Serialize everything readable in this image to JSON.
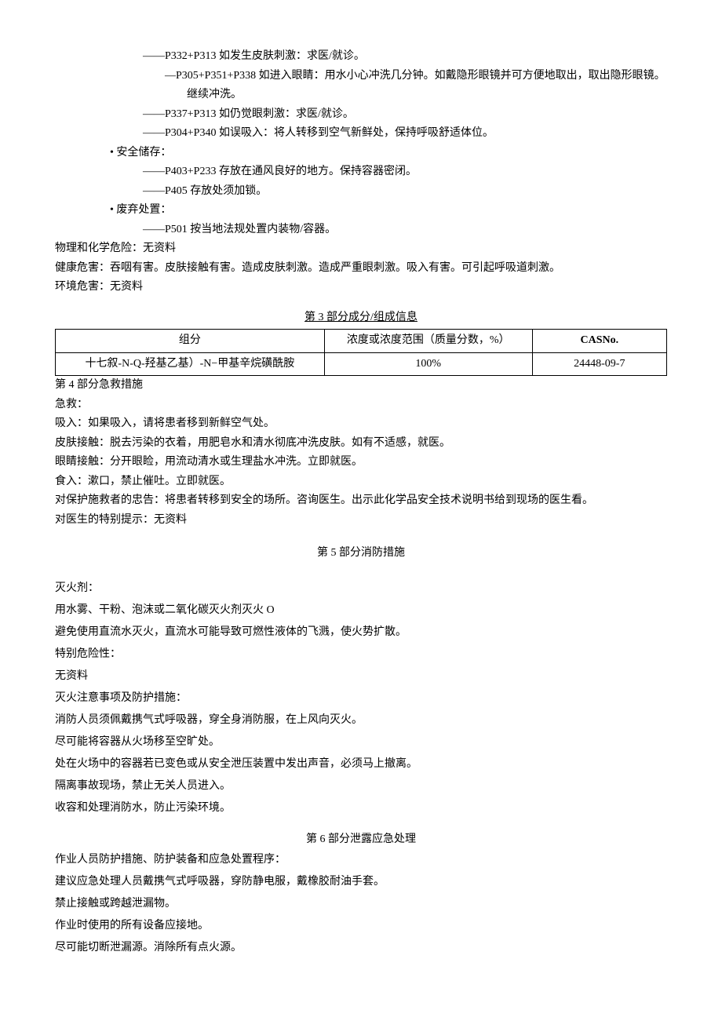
{
  "top": {
    "l1": "——P332+P313 如发生皮肤刺激：求医/就诊。",
    "l2": "—P305+P351+P338 如进入眼睛：用水小心冲洗几分钟。如戴隐形眼镜并可方便地取出，取出隐形眼镜。继续冲洗。",
    "l3": "——P337+P313 如仍觉眼刺激：求医/就诊。",
    "l4": "——P304+P340 如误吸入：将人转移到空气新鲜处，保持呼吸舒适体位。",
    "storage_label": "• 安全储存：",
    "s1": "——P403+P233 存放在通风良好的地方。保持容器密闭。",
    "s2": "——P405 存放处须加锁。",
    "disposal_label": "• 废弃处置：",
    "d1": "——P501 按当地法规处置内装物/容器。",
    "ph": "物理和化学危险：无资料",
    "hh": "健康危害：吞咽有害。皮肤接触有害。造成皮肤刺激。造成严重眼刺激。吸入有害。可引起呼吸道刺激。",
    "eh": "环境危害：无资料"
  },
  "sec3": {
    "title": "第 3 部分成分/组成信息",
    "headers": {
      "c1": "组分",
      "c2": "浓度或浓度范围（质量分数，%）",
      "c3": "CASNo."
    },
    "row": {
      "c1": "十七叙-N-Q-羟基乙基）-N−甲基辛烷磺酰胺",
      "c2": "100%",
      "c3": "24448-09-7"
    }
  },
  "sec4": {
    "heading": "第 4 部分急救措施",
    "l1": "急救：",
    "l2": "吸入：如果吸入，请将患者移到新鲜空气处。",
    "l3": "皮肤接触：脱去污染的衣着，用肥皂水和清水彻底冲洗皮肤。如有不适感，就医。",
    "l4": "眼睛接触：分开眼睑，用流动清水或生理盐水冲洗。立即就医。",
    "l5": "食入：漱口，禁止催吐。立即就医。",
    "l6": "对保护施救者的忠告：将患者转移到安全的场所。咨询医生。出示此化学品安全技术说明书给到现场的医生看。",
    "l7": "对医生的特别提示：无资料"
  },
  "sec5": {
    "title": "第 5 部分消防措施",
    "l1": "灭火剂：",
    "l2": "用水雾、干粉、泡沫或二氧化碳灭火剂灭火 O",
    "l3": "避免使用直流水灭火，直流水可能导致可燃性液体的飞溅，使火势扩散。",
    "l4": "特别危险性：",
    "l5": "无资料",
    "l6": "灭火注意事项及防护措施：",
    "l7": "消防人员须佩戴携气式呼吸器，穿全身消防服，在上风向灭火。",
    "l8": "尽可能将容器从火场移至空旷处。",
    "l9": "处在火场中的容器若已变色或从安全泄压装置中发出声音，必须马上撤离。",
    "l10": "隔离事故现场，禁止无关人员进入。",
    "l11": "收容和处理消防水，防止污染环境。"
  },
  "sec6": {
    "title": "第 6 部分泄露应急处理",
    "l1": "作业人员防护措施、防护装备和应急处置程序：",
    "l2": "建议应急处理人员戴携气式呼吸器，穿防静电服，戴橡胶耐油手套。",
    "l3": "禁止接触或跨越泄漏物。",
    "l4": "作业时使用的所有设备应接地。",
    "l5": "尽可能切断泄漏源。消除所有点火源。"
  }
}
